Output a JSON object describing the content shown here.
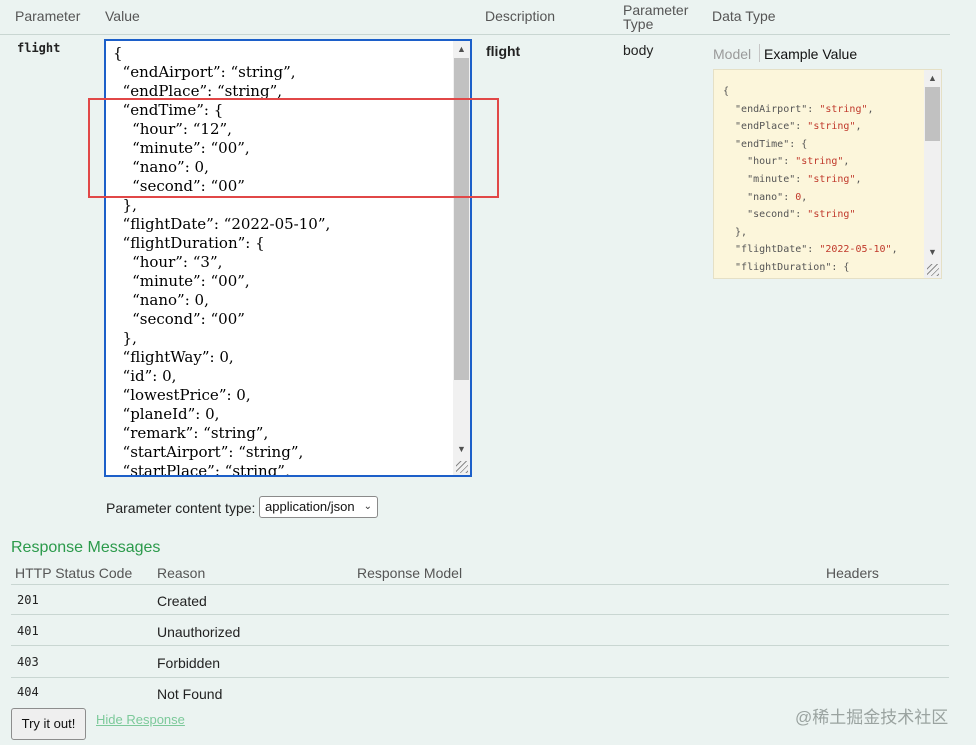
{
  "params_table": {
    "headers": {
      "parameter": "Parameter",
      "value": "Value",
      "description": "Description",
      "parameter_type_line1": "Parameter",
      "parameter_type_line2": "Type",
      "data_type": "Data Type"
    },
    "row": {
      "name": "flight",
      "description": "flight",
      "parameter_type": "body",
      "body_value": "{\n  “endAirport”: “string”,\n  “endPlace”: “string”,\n  “endTime”: {\n    “hour”: “12”,\n    “minute”: “00”,\n    “nano”: 0,\n    “second”: “00”\n  },\n  “flightDate”: “2022-05-10”,\n  “flightDuration”: {\n    “hour”: “3”,\n    “minute”: “00”,\n    “nano”: 0,\n    “second”: “00”\n  },\n  “flightWay”: 0,\n  “id”: 0,\n  “lowestPrice”: 0,\n  “planeId”: 0,\n  “remark”: “string”,\n  “startAirport”: “string”,\n  “startPlace”: “string”,"
    }
  },
  "data_type": {
    "tab_model": "Model",
    "tab_example": "Example Value",
    "example_lines": [
      "{",
      "  \"endAirport\": \"string\",",
      "  \"endPlace\": \"string\",",
      "  \"endTime\": {",
      "    \"hour\": \"string\",",
      "    \"minute\": \"string\",",
      "    \"nano\": 0,",
      "    \"second\": \"string\"",
      "  },",
      "  \"flightDate\": \"2022-05-10\",",
      "  \"flightDuration\": {",
      "    \"hour\": \"string\","
    ]
  },
  "content_type": {
    "label": "Parameter content type:",
    "selected": "application/json"
  },
  "responses": {
    "title": "Response Messages",
    "headers": {
      "status": "HTTP Status Code",
      "reason": "Reason",
      "model": "Response Model",
      "headers": "Headers"
    },
    "rows": [
      {
        "code": "201",
        "reason": "Created"
      },
      {
        "code": "401",
        "reason": "Unauthorized"
      },
      {
        "code": "403",
        "reason": "Forbidden"
      },
      {
        "code": "404",
        "reason": "Not Found"
      }
    ]
  },
  "actions": {
    "try_label": "Try it out!",
    "hide_label": "Hide Response"
  },
  "watermark": "@稀土掘金技术社区",
  "icons": {
    "scroll_up": "scroll-up-arrow-icon",
    "scroll_down": "scroll-down-arrow-icon",
    "resize": "resize-grip-icon",
    "dropdown": "chevron-down-icon"
  },
  "colors": {
    "background": "#ebf3f1",
    "editor_border": "#1c5fc9",
    "highlight_box": "#e14747",
    "sample_bg": "#fcf6db",
    "response_title": "#2b9a4b",
    "hide_link": "#7cc99a"
  }
}
